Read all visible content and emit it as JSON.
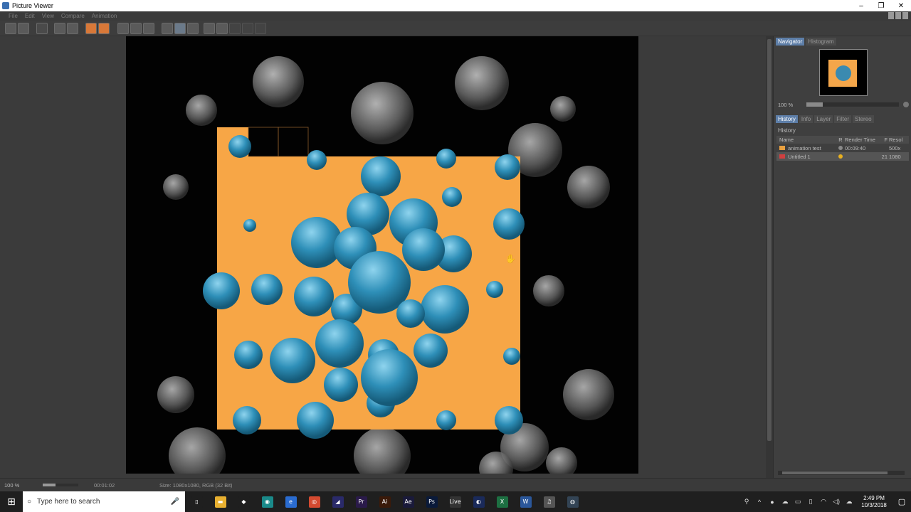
{
  "window": {
    "title": "Picture Viewer"
  },
  "menu": [
    "File",
    "Edit",
    "View",
    "Compare",
    "Animation"
  ],
  "navigator": {
    "tabs": [
      "Navigator",
      "Histogram"
    ],
    "zoom": "100 %",
    "zoom_fraction": 0.18
  },
  "panel_tabs": [
    "History",
    "Info",
    "Layer",
    "Filter",
    "Stereo"
  ],
  "history": {
    "title": "History",
    "columns": [
      "Name",
      "R",
      "Render Time",
      "F",
      "Resol"
    ],
    "rows": [
      {
        "name": "animation test",
        "render_time": "00:09:40",
        "frames": "",
        "resolution": "500x",
        "swatch": "#e8a040",
        "dot": "#8a8a8a"
      },
      {
        "name": "Untitled 1",
        "render_time": "",
        "frames": "21",
        "resolution": "1080",
        "swatch": "#d04040",
        "dot": "#e8b020"
      }
    ]
  },
  "status": {
    "zoom": "100 %",
    "time": "00:01:02",
    "size": "Size: 1080x1080, RGB (32 Bit)"
  },
  "taskbar": {
    "search_placeholder": "Type here to search",
    "apps": [
      {
        "name": "task-view",
        "glyph": "▯",
        "color": "#1f1f1f"
      },
      {
        "name": "file-explorer",
        "glyph": "▬",
        "color": "#e8b030"
      },
      {
        "name": "store",
        "glyph": "◆",
        "color": "#1f1f1f"
      },
      {
        "name": "chrome-dev",
        "glyph": "◉",
        "color": "#1a8a8a"
      },
      {
        "name": "edge",
        "glyph": "e",
        "color": "#2a6cd0"
      },
      {
        "name": "chrome",
        "glyph": "◎",
        "color": "#d44a30"
      },
      {
        "name": "media-encoder",
        "glyph": "◢",
        "color": "#2a2a6a"
      },
      {
        "name": "premiere",
        "glyph": "Pr",
        "color": "#2a1a4a"
      },
      {
        "name": "illustrator",
        "glyph": "Ai",
        "color": "#3a1a0a"
      },
      {
        "name": "after-effects",
        "glyph": "Ae",
        "color": "#1a1a3a"
      },
      {
        "name": "photoshop",
        "glyph": "Ps",
        "color": "#0a1a3a"
      },
      {
        "name": "live",
        "glyph": "Live",
        "color": "#333333"
      },
      {
        "name": "cinema4d",
        "glyph": "◐",
        "color": "#1a2a5a"
      },
      {
        "name": "excel",
        "glyph": "X",
        "color": "#1d6f42"
      },
      {
        "name": "word",
        "glyph": "W",
        "color": "#2b579a"
      },
      {
        "name": "itunes",
        "glyph": "♫",
        "color": "#555555"
      },
      {
        "name": "other-app",
        "glyph": "◍",
        "color": "#334455"
      }
    ],
    "time": "2:49 PM",
    "date": "10/3/2018"
  }
}
